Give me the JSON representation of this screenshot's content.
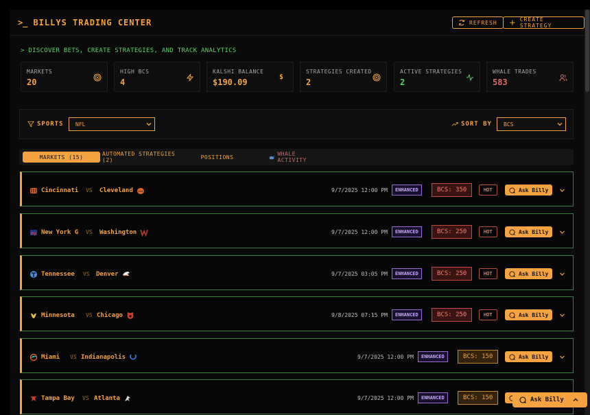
{
  "header": {
    "prompt_symbol": ">_",
    "title": "BILLYS TRADING CENTER",
    "refresh_label": "REFRESH",
    "create_label": "CREATE STRATEGY"
  },
  "subtitle": "> DISCOVER BETS, CREATE STRATEGIES, AND TRACK ANALYTICS",
  "stats": [
    {
      "label": "MARKETS",
      "value": "20",
      "icon": "target-icon",
      "color": "#f4a340"
    },
    {
      "label": "HIGH BCS",
      "value": "4",
      "icon": "lightning-icon",
      "color": "#f4a340"
    },
    {
      "label": "KALSHI BALANCE",
      "value": "$190.09",
      "icon": "dollar-icon",
      "icon_text": "$",
      "color": "#f4a340"
    },
    {
      "label": "STRATEGIES CREATED",
      "value": "2",
      "icon": "target-icon",
      "color": "#f4a340"
    },
    {
      "label": "ACTIVE STRATEGIES",
      "value": "2",
      "icon": "activity-icon",
      "color": "#5fd36a"
    },
    {
      "label": "WHALE TRADES",
      "value": "583",
      "icon": "users-icon",
      "color": "#e36a6a"
    }
  ],
  "filters": {
    "sports_label": "SPORTS",
    "sports_value": "NFL",
    "sort_label": "SORT BY",
    "sort_value": "BCS"
  },
  "tabs": [
    {
      "label": "MARKETS (15)",
      "active": true
    },
    {
      "label": "AUTOMATED STRATEGIES (2)",
      "active": false
    },
    {
      "label": "POSITIONS",
      "active": false
    },
    {
      "label": "WHALE ACTIVITY",
      "active": false
    }
  ],
  "vs_label": "VS",
  "hot_label": "HOT",
  "ask_label": "Ask Billy",
  "enhanced_label": "ENHANCED",
  "markets": [
    {
      "home": "Cincinnati",
      "away": "Cleveland",
      "home_icon": "bengals-icon",
      "away_icon": "browns-icon",
      "datetime": "9/7/2025 12:00 PM",
      "bcs": "BCS: 350",
      "bcs_level": "red",
      "hot": true
    },
    {
      "home": "New York G",
      "away": "Washington",
      "home_icon": "giants-icon",
      "away_icon": "commanders-icon",
      "datetime": "9/7/2025 12:00 PM",
      "bcs": "BCS: 250",
      "bcs_level": "red",
      "hot": true
    },
    {
      "home": "Tennessee",
      "away": "Denver",
      "home_icon": "titans-icon",
      "away_icon": "broncos-icon",
      "datetime": "9/7/2025 03:05 PM",
      "bcs": "BCS: 250",
      "bcs_level": "red",
      "hot": true
    },
    {
      "home": "Minnesota",
      "away": "Chicago",
      "home_icon": "vikings-icon",
      "away_icon": "bears-icon",
      "datetime": "9/8/2025 07:15 PM",
      "bcs": "BCS: 250",
      "bcs_level": "red",
      "hot": true
    },
    {
      "home": "Miami",
      "away": "Indianapolis",
      "home_icon": "dolphins-icon",
      "away_icon": "colts-icon",
      "datetime": "9/7/2025 12:00 PM",
      "bcs": "BCS: 150",
      "bcs_level": "orange",
      "hot": false
    },
    {
      "home": "Tampa Bay",
      "away": "Atlanta",
      "home_icon": "buccaneers-icon",
      "away_icon": "falcons-icon",
      "datetime": "9/7/2025 12:00 PM",
      "bcs": "BCS: 150",
      "bcs_level": "orange",
      "hot": false
    }
  ],
  "floating_ask_label": "Ask Billy"
}
